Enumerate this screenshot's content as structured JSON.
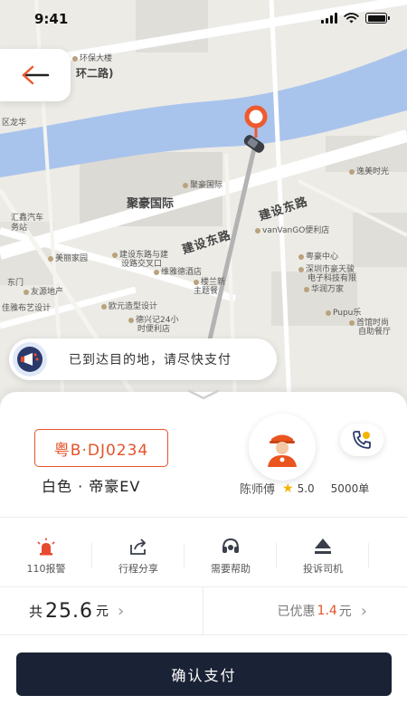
{
  "status_bar": {
    "time": "9:41"
  },
  "map": {
    "labels": {
      "huanbao": "环保大楼",
      "ring2": "环二路)",
      "longhua": "区龙华",
      "jvhao_building": "聚豪国际",
      "jvhao_poi": "聚豪国际",
      "yimei": "逸美时光",
      "jianshe_road_right": "建设东路",
      "jianshe_road_left": "建设东路",
      "vanvango": "vanVanGO便利店",
      "huixin": "汇鑫汽车",
      "huixin2": "务站",
      "meilijia": "美丽家园",
      "jianshe_cross": "建设东路与建",
      "jianshe_cross2": "设路交叉口",
      "weijun": "维雅德酒店",
      "yuehao": "粤豪中心",
      "shenzhen_ecom": "深圳市豪天骏",
      "shenzhen_ecom2": "电子科技有限",
      "huarun": "华润万家",
      "dongmen": "东门",
      "youyuan": "友源地产",
      "louyi": "楼兰新",
      "louyi2": "主题餐",
      "ouyuan": "欧元造型设计",
      "jiaya": "佳雅布艺设计",
      "pupu": "Pupu乐",
      "night_snack": "德兴记24小",
      "night_snack2": "时便利店",
      "shouguan": "首馆时尚",
      "shouguan2": "自助餐厅"
    }
  },
  "notice": {
    "text": "已到达目的地，请尽快支付"
  },
  "car": {
    "plate": "粤B·DJ0234",
    "description": "白色 · 帝豪EV"
  },
  "driver": {
    "name": "陈师傅",
    "rating": "5.0",
    "orders": "5000单"
  },
  "actions": [
    {
      "label": "110报警",
      "icon": "alarm-light-icon"
    },
    {
      "label": "行程分享",
      "icon": "share-icon"
    },
    {
      "label": "需要帮助",
      "icon": "headset-icon"
    },
    {
      "label": "投诉司机",
      "icon": "complaint-icon"
    }
  ],
  "fare": {
    "prefix": "共",
    "amount": "25.6",
    "unit": "元",
    "discount_prefix": "已优惠",
    "discount_amount": "1.4",
    "discount_unit": "元"
  },
  "pay_button": {
    "label": "确认支付"
  },
  "colors": {
    "accent": "#e4532a",
    "primary_button": "#1a2235",
    "river": "#a9c4ec",
    "star": "#f5b400"
  }
}
